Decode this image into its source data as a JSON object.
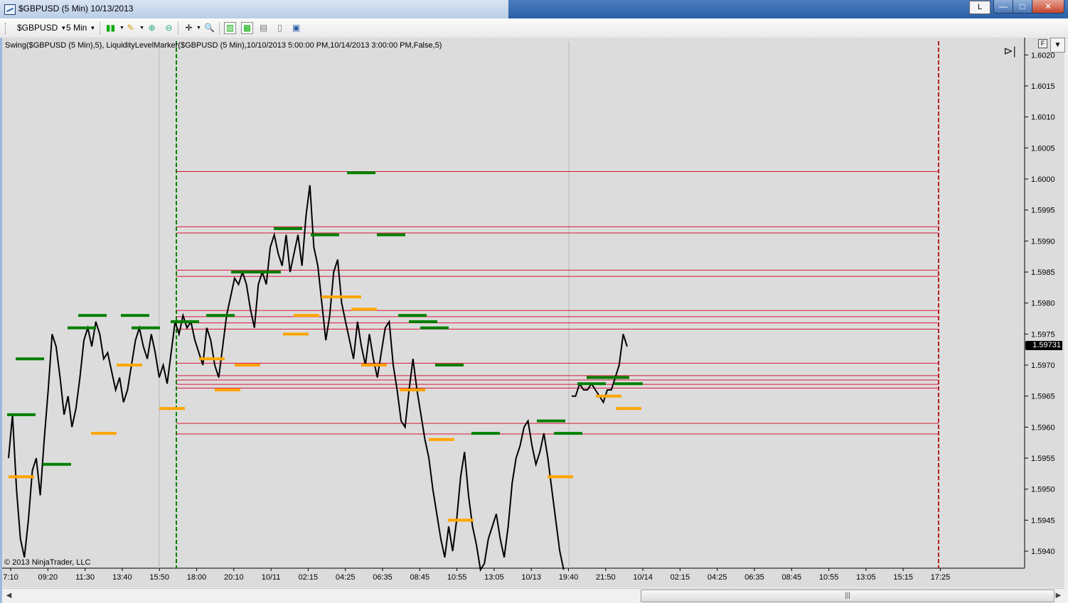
{
  "window": {
    "title": "$GBPUSD (5 Min)  10/13/2013",
    "link_button": "L",
    "min_label": "—",
    "max_label": "□",
    "close_label": "✕"
  },
  "toolbar": {
    "instrument": "$GBPUSD",
    "interval": "5 Min"
  },
  "indicator_label": "Swing($GBPUSD (5 Min),5), LiquidityLevelMarker($GBPUSD (5 Min),10/10/2013 5:00:00 PM,10/14/2013 3:00:00 PM,False,5)",
  "copyright": "© 2013 NinjaTrader, LLC",
  "panel_button": "F",
  "current_price": "1.59731",
  "colors": {
    "background": "#dcdcdc",
    "swing_high": "#008000",
    "swing_low": "#ffa500",
    "liquidity_line": "#dc143c",
    "price": "#000000"
  },
  "chart_data": {
    "type": "line",
    "title": "",
    "instrument": "$GBPUSD",
    "interval": "5 Min",
    "y_range": [
      1.59375,
      1.6025
    ],
    "y_ticks": [
      "1.6020",
      "1.6015",
      "1.6010",
      "1.6005",
      "1.6000",
      "1.5995",
      "1.5990",
      "1.5985",
      "1.5980",
      "1.5975",
      "1.5970",
      "1.5965",
      "1.5960",
      "1.5955",
      "1.5950",
      "1.5945",
      "1.5940"
    ],
    "x_ticks": [
      "7:10",
      "09:20",
      "11:30",
      "13:40",
      "15:50",
      "18:00",
      "20:10",
      "10/11",
      "02:15",
      "04:25",
      "06:35",
      "08:45",
      "10:55",
      "13:05",
      "10/13",
      "19:40",
      "21:50",
      "10/14",
      "02:15",
      "04:25",
      "06:35",
      "08:45",
      "10:55",
      "13:05",
      "15:15",
      "17:25"
    ],
    "last_price": 1.59731,
    "session_start": "10/10/2013 5:00:00 PM",
    "session_end": "10/14/2013 3:00:00 PM",
    "liquidity_levels": [
      1.60012,
      1.59923,
      1.59913,
      1.59853,
      1.59843,
      1.59788,
      1.59778,
      1.59768,
      1.59758,
      1.59703,
      1.59683,
      1.59676,
      1.59669,
      1.59663,
      1.59606,
      1.59589
    ],
    "swing_highs": [
      1.5971,
      1.5962,
      1.5954,
      1.5976,
      1.5978,
      1.5978,
      1.5976,
      1.5977,
      1.5978,
      1.5985,
      1.5985,
      1.5992,
      1.5991,
      1.6001,
      1.5991,
      1.5978,
      1.5977,
      1.5976,
      1.597,
      1.5959,
      1.5961,
      1.5959,
      1.5967,
      1.5968,
      1.5968,
      1.5967
    ],
    "swing_lows": [
      1.5952,
      1.5959,
      1.597,
      1.5963,
      1.5971,
      1.5966,
      1.597,
      1.5975,
      1.5978,
      1.5981,
      1.5981,
      1.5979,
      1.597,
      1.5966,
      1.5958,
      1.5945,
      1.5952,
      1.5965,
      1.5963
    ],
    "price_series": [
      1.5955,
      1.5962,
      1.595,
      1.5942,
      1.5939,
      1.5945,
      1.5953,
      1.5955,
      1.5949,
      1.5958,
      1.5966,
      1.5975,
      1.5973,
      1.5968,
      1.5962,
      1.5965,
      1.596,
      1.5963,
      1.5968,
      1.5974,
      1.5976,
      1.5973,
      1.5977,
      1.5975,
      1.5971,
      1.5972,
      1.5969,
      1.5966,
      1.5968,
      1.5964,
      1.5966,
      1.597,
      1.5974,
      1.5976,
      1.5973,
      1.5971,
      1.5975,
      1.5972,
      1.5968,
      1.597,
      1.5967,
      1.5972,
      1.5977,
      1.5975,
      1.5978,
      1.5976,
      1.5977,
      1.5974,
      1.5972,
      1.597,
      1.5976,
      1.5974,
      1.597,
      1.5968,
      1.5973,
      1.5978,
      1.5981,
      1.5984,
      1.5983,
      1.5985,
      1.5983,
      1.5979,
      1.5976,
      1.5983,
      1.5985,
      1.5983,
      1.5989,
      1.5991,
      1.5988,
      1.5986,
      1.5991,
      1.5985,
      1.5988,
      1.5991,
      1.5986,
      1.5994,
      1.5999,
      1.5989,
      1.5986,
      1.598,
      1.5974,
      1.5978,
      1.5985,
      1.5987,
      1.598,
      1.5977,
      1.5974,
      1.5971,
      1.5977,
      1.5973,
      1.597,
      1.5975,
      1.5971,
      1.5968,
      1.5972,
      1.5976,
      1.5977,
      1.597,
      1.5966,
      1.5961,
      1.596,
      1.5966,
      1.5971,
      1.5966,
      1.5962,
      1.5958,
      1.5955,
      1.595,
      1.5946,
      1.5942,
      1.5939,
      1.5944,
      1.594,
      1.5945,
      1.5952,
      1.5956,
      1.5949,
      1.5944,
      1.5941,
      1.5937,
      1.5938,
      1.5942,
      1.5944,
      1.5946,
      1.5942,
      1.5939,
      1.5944,
      1.5951,
      1.5955,
      1.5957,
      1.596,
      1.5961,
      1.5957,
      1.5954,
      1.5956,
      1.5959,
      1.5955,
      1.595,
      1.5945,
      1.594,
      1.5937,
      null,
      1.5965,
      1.5965,
      1.5967,
      1.5966,
      1.5966,
      1.5967,
      1.5966,
      1.5965,
      1.5964,
      1.5966,
      1.5966,
      1.5968,
      1.597,
      1.5975,
      1.5973
    ]
  }
}
